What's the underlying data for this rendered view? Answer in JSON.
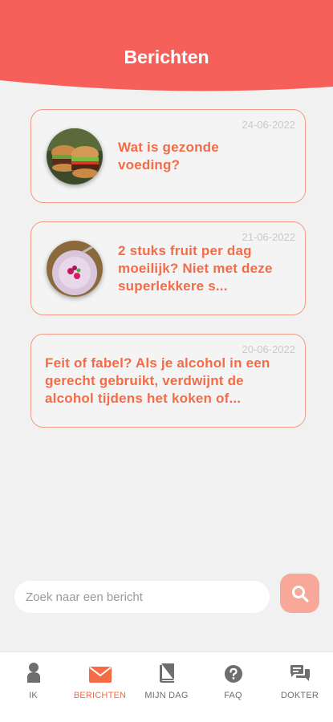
{
  "header": {
    "title": "Berichten"
  },
  "messages": [
    {
      "date": "24-06-2022",
      "title": "Wat is gezonde voeding?",
      "image": "burger-photo"
    },
    {
      "date": "21-06-2022",
      "title": "2 stuks fruit per dag moeilijk? Niet met deze superlekkere s...",
      "image": "smoothie-photo"
    },
    {
      "date": "20-06-2022",
      "title": "Feit of fabel? Als je alcohol in een gerecht gebruikt, verdwijnt de alcohol tijdens het koken of..."
    }
  ],
  "search": {
    "placeholder": "Zoek naar een bericht",
    "icon": "search-icon"
  },
  "nav": {
    "items": [
      {
        "label": "IK",
        "icon": "person-icon"
      },
      {
        "label": "BERICHTEN",
        "icon": "envelope-icon",
        "active": true
      },
      {
        "label": "MIJN DAG",
        "icon": "book-icon"
      },
      {
        "label": "FAQ",
        "icon": "question-icon"
      },
      {
        "label": "DOKTER",
        "icon": "chat-icon"
      }
    ]
  },
  "colors": {
    "accent": "#f46b45",
    "header": "#f7605a",
    "card_border": "#f39b85",
    "background": "#f1f1f1"
  }
}
